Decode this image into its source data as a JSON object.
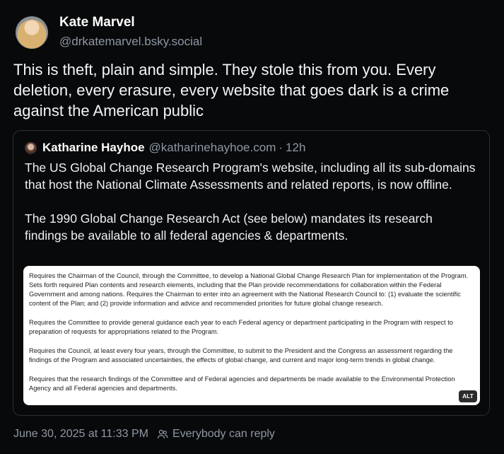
{
  "author": {
    "display_name": "Kate Marvel",
    "handle": "@drkatemarvel.bsky.social"
  },
  "post": {
    "text": "This is theft, plain and simple. They stole this from you.  Every deletion, every erasure, every website that goes dark is a crime against the American public"
  },
  "quoted_post": {
    "author_name": "Katharine Hayhoe",
    "author_handle": "@katharinehayhoe.com",
    "separator": "·",
    "time": "12h",
    "paragraphs": [
      "The US Global Change Research Program's website, including all its sub-domains that host the National Climate Assessments and related reports, is now offline.",
      "The 1990 Global Change Research Act (see below) mandates its research findings be available to all federal agencies & departments."
    ],
    "image": {
      "paragraphs": [
        "Requires the Chairman of the Council, through the Committee, to develop a National Global Change Research Plan for implementation of the Program. Sets forth required Plan contents and research elements, including that the Plan provide recommendations for collaboration within the Federal Government and among nations. Requires the Chairman to enter into an agreement with the National Research Council to: (1) evaluate the scientific content of the Plan; and (2) provide information and advice and recommended priorities for future global change research.",
        "Requires the Committee to provide general guidance each year to each Federal agency or department participating in the Program with respect to preparation of requests for appropriations related to the Program.",
        "Requires the Council, at least every four years, through the Committee, to submit to the President and the Congress an assessment regarding the findings of the Program and associated uncertainties, the effects of global change, and current and major long-term trends in global change.",
        "Requires that the research findings of the Committee and of Federal agencies and departments be made available to the Environmental Protection Agency and all Federal agencies and departments."
      ],
      "alt_badge": "ALT"
    }
  },
  "footer": {
    "timestamp": "June 30, 2025 at 11:33 PM",
    "reply_setting": "Everybody can reply",
    "icon": "people-icon"
  }
}
